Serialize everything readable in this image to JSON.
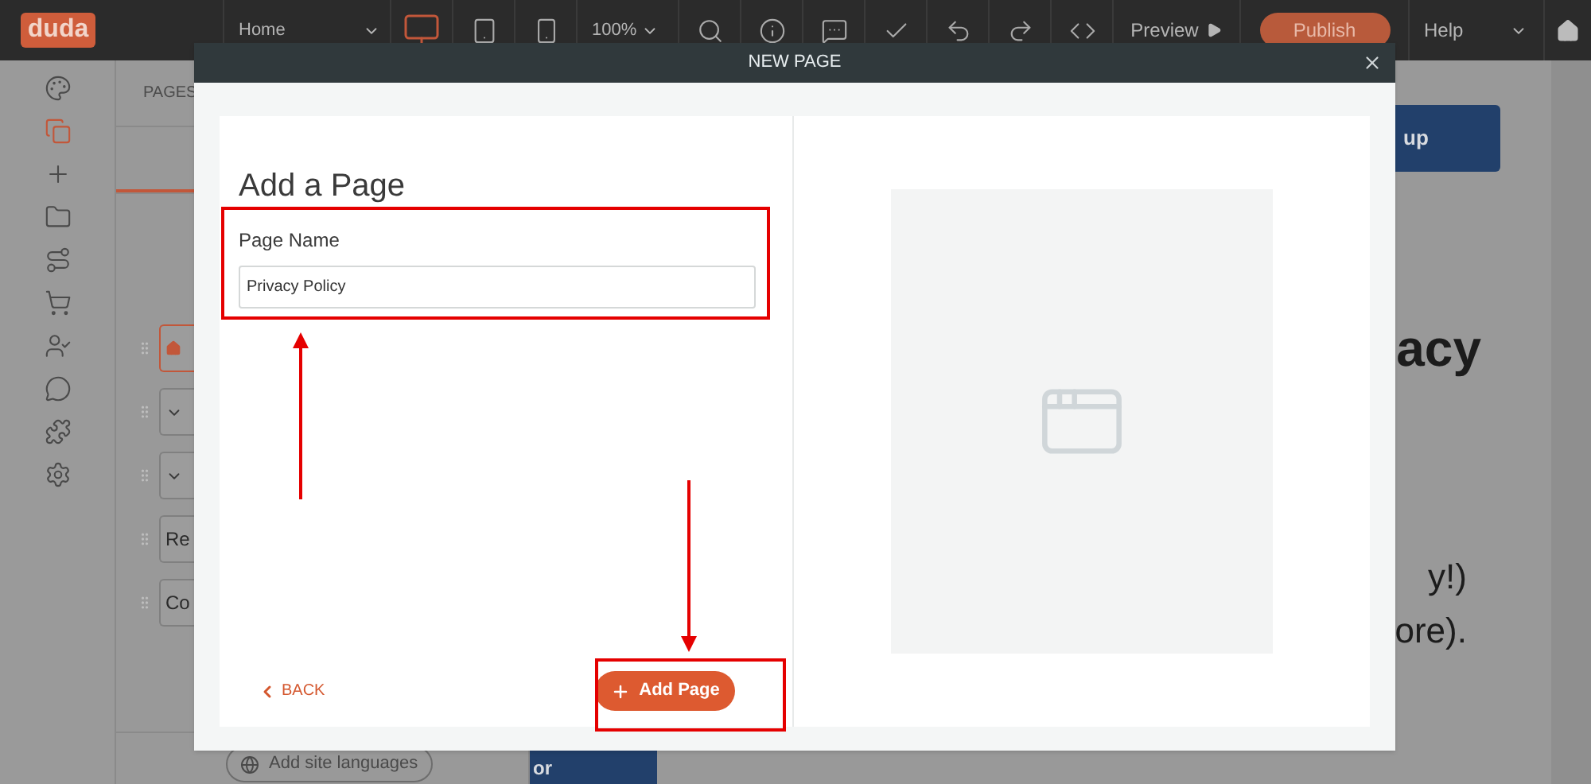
{
  "top_bar": {
    "logo": "duda",
    "page_select": "Home",
    "devices": [
      {
        "kind": "desktop",
        "selected": true
      },
      {
        "kind": "tablet",
        "selected": false
      },
      {
        "kind": "mobile",
        "selected": false
      }
    ],
    "zoom": "100%",
    "preview": "Preview",
    "publish": "Publish",
    "help": "Help"
  },
  "sidebar": {
    "items": [
      {
        "kind": "design",
        "selected": false
      },
      {
        "kind": "pages",
        "selected": true
      },
      {
        "kind": "add",
        "selected": false
      },
      {
        "kind": "content",
        "selected": false
      },
      {
        "kind": "flow",
        "selected": false
      },
      {
        "kind": "store",
        "selected": false
      },
      {
        "kind": "members",
        "selected": false
      },
      {
        "kind": "comments",
        "selected": false
      },
      {
        "kind": "plugins",
        "selected": false
      },
      {
        "kind": "settings",
        "selected": false
      }
    ]
  },
  "pages_panel": {
    "title": "PAGES",
    "pages": [
      {
        "kind": "home",
        "selected": true
      },
      {
        "kind": "group",
        "selected": false
      },
      {
        "kind": "group",
        "selected": false
      },
      {
        "kind": "page",
        "label": "Re",
        "selected": false
      },
      {
        "kind": "page",
        "label": "Co",
        "selected": false
      }
    ],
    "language_button": "Add site languages"
  },
  "canvas": {
    "button": "up",
    "heading": "acy",
    "lines": [
      "y!)",
      "ore)."
    ],
    "banner": "or"
  },
  "dialog": {
    "title": "NEW PAGE",
    "heading": "Add a Page",
    "field": {
      "label": "Page Name",
      "value": "Privacy Policy"
    },
    "back": "BACK",
    "submit": "Add Page"
  }
}
